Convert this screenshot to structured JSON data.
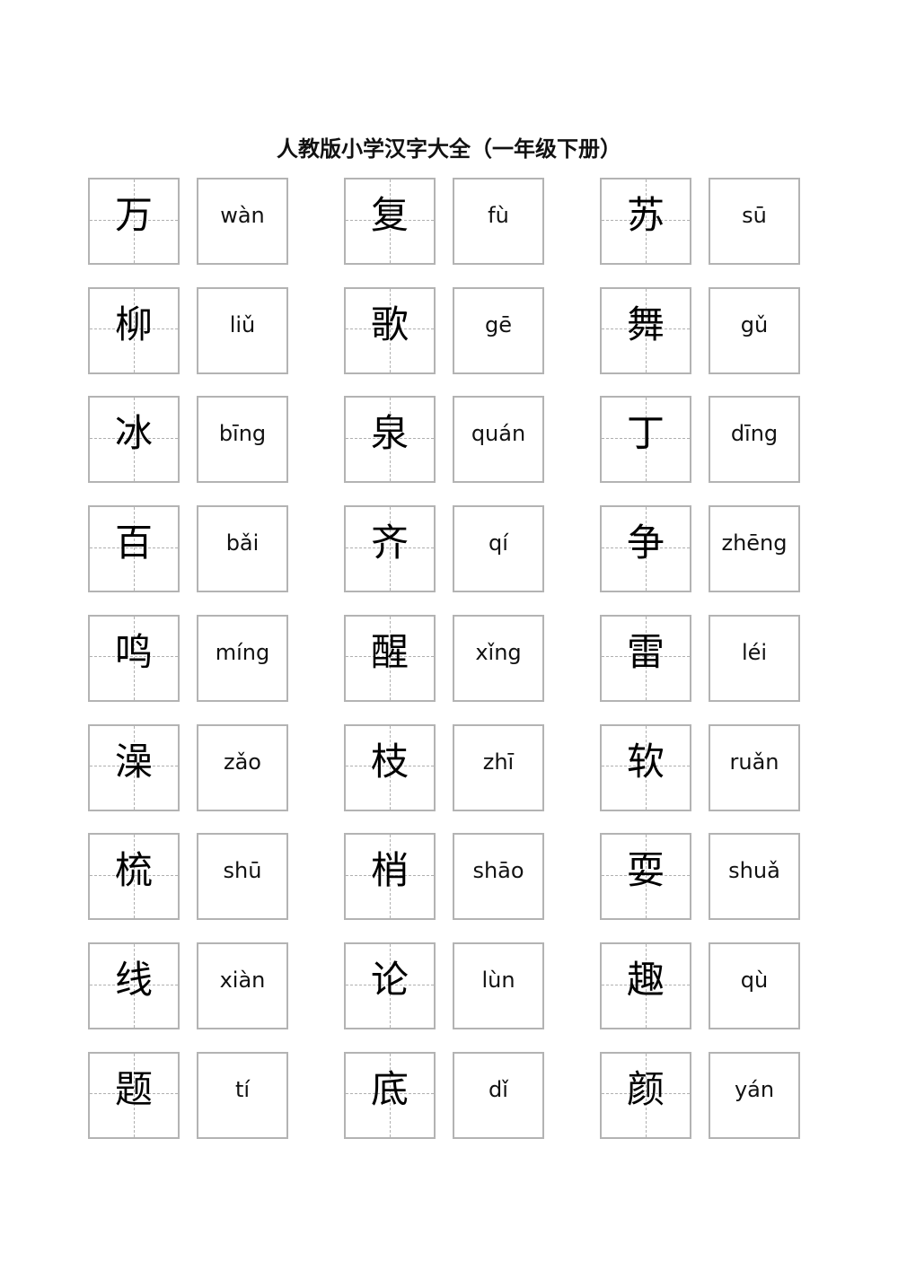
{
  "title": "人教版小学汉字大全（一年级下册）",
  "rows": [
    [
      {
        "char": "万",
        "pinyin": "wàn"
      },
      {
        "char": "复",
        "pinyin": "fù"
      },
      {
        "char": "苏",
        "pinyin": "sū"
      }
    ],
    [
      {
        "char": "柳",
        "pinyin": "liǔ"
      },
      {
        "char": "歌",
        "pinyin": "gē"
      },
      {
        "char": "舞",
        "pinyin": "gǔ"
      }
    ],
    [
      {
        "char": "冰",
        "pinyin": "bīng"
      },
      {
        "char": "泉",
        "pinyin": "quán"
      },
      {
        "char": "丁",
        "pinyin": "dīng"
      }
    ],
    [
      {
        "char": "百",
        "pinyin": "bǎi"
      },
      {
        "char": "齐",
        "pinyin": "qí"
      },
      {
        "char": "争",
        "pinyin": "zhēng"
      }
    ],
    [
      {
        "char": "鸣",
        "pinyin": "míng"
      },
      {
        "char": "醒",
        "pinyin": "xǐng"
      },
      {
        "char": "雷",
        "pinyin": "léi"
      }
    ],
    [
      {
        "char": "澡",
        "pinyin": "zǎo"
      },
      {
        "char": "枝",
        "pinyin": "zhī"
      },
      {
        "char": "软",
        "pinyin": "ruǎn"
      }
    ],
    [
      {
        "char": "梳",
        "pinyin": "shū"
      },
      {
        "char": "梢",
        "pinyin": "shāo"
      },
      {
        "char": "耍",
        "pinyin": "shuǎ"
      }
    ],
    [
      {
        "char": "线",
        "pinyin": "xiàn"
      },
      {
        "char": "论",
        "pinyin": "lùn"
      },
      {
        "char": "趣",
        "pinyin": "qù"
      }
    ],
    [
      {
        "char": "题",
        "pinyin": "tí"
      },
      {
        "char": "底",
        "pinyin": "dǐ"
      },
      {
        "char": "颜",
        "pinyin": "yán"
      }
    ]
  ]
}
